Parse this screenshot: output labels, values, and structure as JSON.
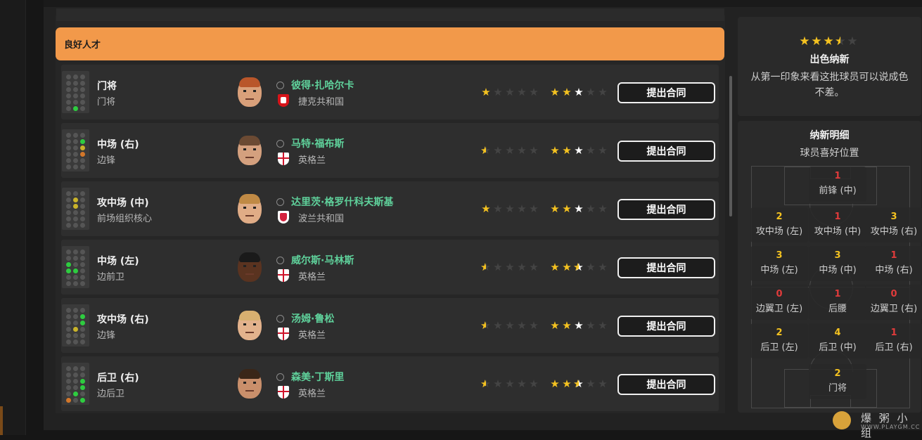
{
  "group": {
    "title": "良好人才"
  },
  "rows": [
    {
      "pos_main": "门将",
      "pos_sub": "门将",
      "name": "彼得·扎哈尔卡",
      "nation": "捷克共和国",
      "flag": "czech",
      "skin": "#d9a07a",
      "hair": "#b9562a",
      "current_rating": 1.0,
      "potential_rating": 3.0,
      "button": "提出合同"
    },
    {
      "pos_main": "中场 (右)",
      "pos_sub": "边锋",
      "name": "马特·福布斯",
      "nation": "英格兰",
      "flag": "england",
      "skin": "#d4a07e",
      "hair": "#6b4a33",
      "current_rating": 0.5,
      "potential_rating": 3.0,
      "button": "提出合同"
    },
    {
      "pos_main": "攻中场 (中)",
      "pos_sub": "前场组织核心",
      "name": "达里茨·格罗什科夫斯基",
      "nation": "波兰共和国",
      "flag": "poland",
      "skin": "#e0ac86",
      "hair": "#c08a45",
      "current_rating": 1.0,
      "potential_rating": 3.0,
      "button": "提出合同"
    },
    {
      "pos_main": "中场 (左)",
      "pos_sub": "边前卫",
      "name": "威尔斯·马林斯",
      "nation": "英格兰",
      "flag": "england",
      "skin": "#5a3320",
      "hair": "#1a1a1a",
      "current_rating": 0.5,
      "potential_rating": 2.5,
      "button": "提出合同"
    },
    {
      "pos_main": "攻中场 (右)",
      "pos_sub": "边锋",
      "name": "汤姆·鲁松",
      "nation": "英格兰",
      "flag": "england",
      "skin": "#e3b28c",
      "hair": "#d7b070",
      "current_rating": 0.5,
      "potential_rating": 3.0,
      "button": "提出合同"
    },
    {
      "pos_main": "后卫 (右)",
      "pos_sub": "边后卫",
      "name": "森美·丁斯里",
      "nation": "英格兰",
      "flag": "england",
      "skin": "#c98f6b",
      "hair": "#3a2618",
      "current_rating": 0.5,
      "potential_rating": 2.5,
      "button": "提出合同"
    }
  ],
  "summary": {
    "rating": 3.5,
    "title": "出色纳新",
    "description": "从第一印象来看这批球员可以说成色不差。"
  },
  "details": {
    "title": "纳新明细",
    "subtitle": "球员喜好位置",
    "positions": [
      {
        "count": "1",
        "label": "前锋 (中)",
        "tone": "red"
      },
      {
        "count": "2",
        "label": "攻中场 (左)",
        "tone": "yel"
      },
      {
        "count": "1",
        "label": "攻中场 (中)",
        "tone": "red"
      },
      {
        "count": "3",
        "label": "攻中场 (右)",
        "tone": "yel"
      },
      {
        "count": "3",
        "label": "中场 (左)",
        "tone": "yel"
      },
      {
        "count": "3",
        "label": "中场 (中)",
        "tone": "yel"
      },
      {
        "count": "1",
        "label": "中场 (右)",
        "tone": "red"
      },
      {
        "count": "0",
        "label": "边翼卫 (左)",
        "tone": "red"
      },
      {
        "count": "1",
        "label": "后腰",
        "tone": "red"
      },
      {
        "count": "0",
        "label": "边翼卫 (右)",
        "tone": "red"
      },
      {
        "count": "2",
        "label": "后卫 (左)",
        "tone": "yel"
      },
      {
        "count": "4",
        "label": "后卫 (中)",
        "tone": "yel"
      },
      {
        "count": "1",
        "label": "后卫 (右)",
        "tone": "red"
      },
      {
        "count": "2",
        "label": "门将",
        "tone": "yel"
      }
    ]
  },
  "watermark": {
    "text": "爆 粥 小 组",
    "url": "WWW.PLAYGM.CC"
  },
  "colors": {
    "accent": "#f2994a",
    "name": "#5fd19b",
    "star": "#f4c220"
  }
}
